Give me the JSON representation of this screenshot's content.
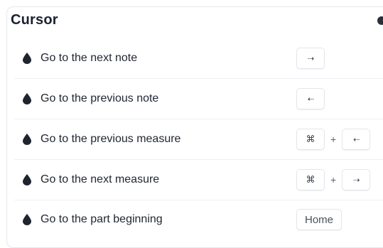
{
  "section": {
    "title": "Cursor"
  },
  "shortcuts": [
    {
      "label": "Go to the next note",
      "keys": [
        "⇢"
      ],
      "key_icons": [
        "arrow-right-icon"
      ]
    },
    {
      "label": "Go to the previous note",
      "keys": [
        "⇠"
      ],
      "key_icons": [
        "arrow-left-icon"
      ]
    },
    {
      "label": "Go to the previous measure",
      "keys": [
        "⌘",
        "⇠"
      ],
      "key_icons": [
        "command-icon",
        "arrow-left-icon"
      ],
      "joiner": "+"
    },
    {
      "label": "Go to the next measure",
      "keys": [
        "⌘",
        "⇢"
      ],
      "key_icons": [
        "command-icon",
        "arrow-right-icon"
      ],
      "joiner": "+"
    },
    {
      "label": "Go to the part beginning",
      "keys": [
        "Home"
      ]
    }
  ],
  "colors": {
    "bullet": "#1f2430",
    "border": "#e6e8ec"
  },
  "icons": {
    "bullet": "droplet-icon"
  }
}
